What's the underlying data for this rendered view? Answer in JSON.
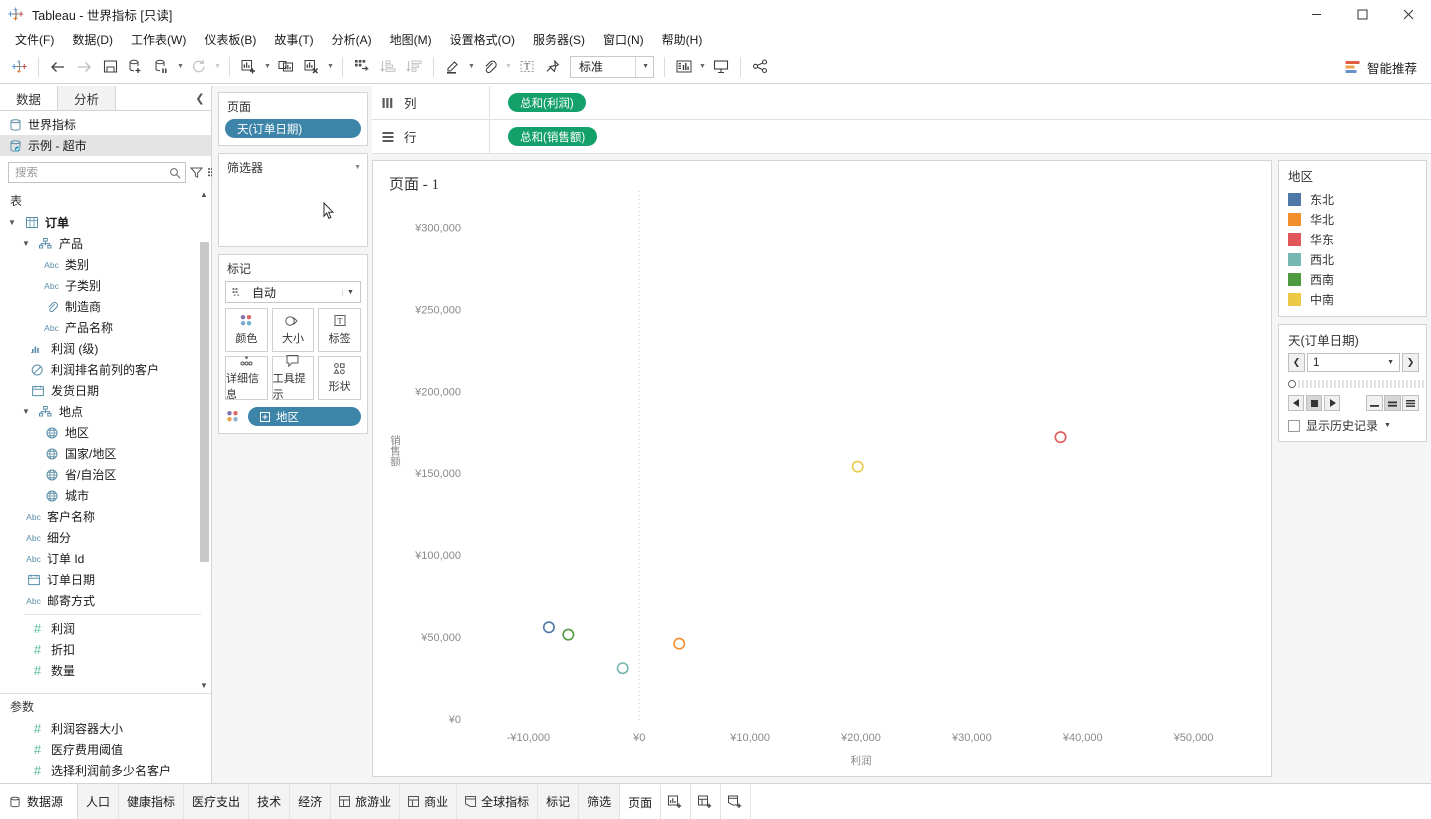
{
  "window": {
    "title": "Tableau - 世界指标 [只读]",
    "app_icon": "tableau-logo-icon",
    "minimize": "—",
    "maximize": "▢",
    "close": "✕"
  },
  "menubar": {
    "items": [
      {
        "label": "文件(F)",
        "name": "menu-file"
      },
      {
        "label": "数据(D)",
        "name": "menu-data"
      },
      {
        "label": "工作表(W)",
        "name": "menu-worksheet"
      },
      {
        "label": "仪表板(B)",
        "name": "menu-dashboard"
      },
      {
        "label": "故事(T)",
        "name": "menu-story"
      },
      {
        "label": "分析(A)",
        "name": "menu-analysis"
      },
      {
        "label": "地图(M)",
        "name": "menu-map"
      },
      {
        "label": "设置格式(O)",
        "name": "menu-format"
      },
      {
        "label": "服务器(S)",
        "name": "menu-server"
      },
      {
        "label": "窗口(N)",
        "name": "menu-window"
      },
      {
        "label": "帮助(H)",
        "name": "menu-help"
      }
    ]
  },
  "toolbar": {
    "fit_value": "标准",
    "show_me_label": "智能推荐",
    "icons": [
      "tableau-home-icon",
      "back-arrow-icon",
      "forward-arrow-icon",
      "save-icon",
      "new-data-source-icon",
      "pause-data-updates-icon",
      "refresh-data-source-icon",
      "new-worksheet-icon",
      "duplicate-sheet-icon",
      "clear-sheet-icon",
      "swap-rows-columns-icon",
      "sort-ascending-icon",
      "sort-descending-icon",
      "highlight-icon",
      "group-members-icon",
      "show-mark-labels-icon",
      "fix-axes-icon",
      "presentation-mode-icon",
      "show-dashboard-icon",
      "share-icon"
    ]
  },
  "left_pane": {
    "tabs": [
      {
        "label": "数据",
        "name": "tab-data",
        "active": true
      },
      {
        "label": "分析",
        "name": "tab-analytics",
        "active": false
      }
    ],
    "collapse_icon": "chevron-left-icon",
    "data_sources": [
      {
        "label": "世界指标",
        "name": "datasource-world-indicators",
        "selected": false,
        "icon": "database-icon"
      },
      {
        "label": "示例 - 超市",
        "name": "datasource-sample-superstore",
        "selected": true,
        "icon": "database-live-icon"
      }
    ],
    "search": {
      "placeholder": "搜索",
      "value": "",
      "icon": "search-icon"
    },
    "search_buttons": [
      "filter-funnel-icon",
      "group-by-folder-icon",
      "chevron-down-icon"
    ],
    "sections": [
      {
        "title": "表",
        "name": "section-tables"
      },
      {
        "title": "参数",
        "name": "section-parameters"
      }
    ],
    "fields": [
      {
        "label": "订单",
        "type": "table",
        "indent": 0,
        "expanded": true,
        "icon": "table-icon",
        "bold": true
      },
      {
        "label": "产品",
        "type": "hierarchy",
        "indent": 1,
        "expanded": true,
        "icon": "hierarchy-icon"
      },
      {
        "label": "类别",
        "type": "string",
        "indent": 2,
        "icon": "abc-icon"
      },
      {
        "label": "子类别",
        "type": "string",
        "indent": 2,
        "icon": "abc-icon"
      },
      {
        "label": "制造商",
        "type": "linked",
        "indent": 2,
        "icon": "paperclip-icon"
      },
      {
        "label": "产品名称",
        "type": "string",
        "indent": 2,
        "icon": "abc-icon"
      },
      {
        "label": "利润 (级)",
        "type": "bin",
        "indent": 1,
        "icon": "bin-icon"
      },
      {
        "label": "利润排名前列的客户",
        "type": "set",
        "indent": 1,
        "icon": "set-icon"
      },
      {
        "label": "发货日期",
        "type": "date",
        "indent": 1,
        "icon": "calendar-icon"
      },
      {
        "label": "地点",
        "type": "hierarchy",
        "indent": 1,
        "expanded": true,
        "icon": "hierarchy-icon"
      },
      {
        "label": "地区",
        "type": "geo",
        "indent": 2,
        "icon": "globe-icon"
      },
      {
        "label": "国家/地区",
        "type": "geo",
        "indent": 2,
        "icon": "globe-icon"
      },
      {
        "label": "省/自治区",
        "type": "geo",
        "indent": 2,
        "icon": "globe-icon"
      },
      {
        "label": "城市",
        "type": "geo",
        "indent": 2,
        "icon": "globe-icon"
      },
      {
        "label": "客户名称",
        "type": "string",
        "indent": 1,
        "icon": "abc-icon"
      },
      {
        "label": "细分",
        "type": "string",
        "indent": 1,
        "icon": "abc-icon"
      },
      {
        "label": "订单 Id",
        "type": "string",
        "indent": 1,
        "icon": "abc-icon"
      },
      {
        "label": "订单日期",
        "type": "date",
        "indent": 1,
        "icon": "calendar-icon"
      },
      {
        "label": "邮寄方式",
        "type": "string",
        "indent": 1,
        "icon": "abc-icon"
      },
      {
        "label": "利润",
        "type": "measure",
        "indent": 1,
        "icon": "hash-icon",
        "divider_before": true
      },
      {
        "label": "折扣",
        "type": "measure",
        "indent": 1,
        "icon": "hash-icon"
      },
      {
        "label": "数量",
        "type": "measure",
        "indent": 1,
        "icon": "hash-icon"
      }
    ],
    "parameters": [
      {
        "label": "利润容器大小",
        "icon": "hash-icon"
      },
      {
        "label": "医疗费用阈值",
        "icon": "hash-icon"
      },
      {
        "label": "选择利润前多少名客户",
        "icon": "hash-icon"
      }
    ]
  },
  "cards": {
    "pages": {
      "title": "页面",
      "pill": "天(订单日期)",
      "pill_color": "#3d85a8"
    },
    "filters": {
      "title": "筛选器",
      "items": []
    },
    "marks": {
      "title": "标记",
      "mark_type": "自动",
      "mark_type_icon": "automatic-marks-icon",
      "buttons": [
        {
          "label": "颜色",
          "name": "marks-color-button",
          "icon": "color-dots-icon"
        },
        {
          "label": "大小",
          "name": "marks-size-button",
          "icon": "size-icon"
        },
        {
          "label": "标签",
          "name": "marks-label-button",
          "icon": "label-text-icon"
        },
        {
          "label": "详细信息",
          "name": "marks-detail-button",
          "icon": "detail-dots-icon"
        },
        {
          "label": "工具提示",
          "name": "marks-tooltip-button",
          "icon": "tooltip-icon"
        },
        {
          "label": "形状",
          "name": "marks-shape-button",
          "icon": "shape-icon"
        }
      ],
      "pill": "地区",
      "pill_icon": "plus-box-icon",
      "pill_color": "#3d85a8"
    }
  },
  "shelves": {
    "columns": {
      "label": "列",
      "icon": "columns-icon",
      "pill": "总和(利润)"
    },
    "rows": {
      "label": "行",
      "icon": "rows-icon",
      "pill": "总和(销售额)"
    }
  },
  "chart_data": {
    "type": "scatter",
    "title": "页面 - 1",
    "xlabel": "利润",
    "ylabel": "销售额",
    "xlim": [
      -15000,
      55000
    ],
    "ylim": [
      0,
      310000
    ],
    "xticks": [
      "-¥10,000",
      "¥0",
      "¥10,000",
      "¥20,000",
      "¥30,000",
      "¥40,000",
      "¥50,000"
    ],
    "xtick_values": [
      -10000,
      0,
      10000,
      20000,
      30000,
      40000,
      50000
    ],
    "yticks": [
      "¥0",
      "¥50,000",
      "¥100,000",
      "¥150,000",
      "¥200,000",
      "¥250,000",
      "¥300,000"
    ],
    "ytick_values": [
      0,
      50000,
      100000,
      150000,
      200000,
      250000,
      300000
    ],
    "grid": false,
    "zero_line_x": 0,
    "legend_title": "地区",
    "series": [
      {
        "name": "东北",
        "color": "#4e79a7",
        "x": -8150,
        "y": 56000
      },
      {
        "name": "华北",
        "color": "#f28e2b",
        "x": 3600,
        "y": 46000
      },
      {
        "name": "华东",
        "color": "#e15759",
        "x": 38000,
        "y": 172000
      },
      {
        "name": "西北",
        "color": "#76b7b2",
        "x": -1500,
        "y": 31000
      },
      {
        "name": "西南",
        "color": "#4e9a3e",
        "x": -6400,
        "y": 51500
      },
      {
        "name": "中南",
        "color": "#edc948",
        "x": 19700,
        "y": 154000
      }
    ]
  },
  "legend": {
    "title": "地区",
    "items": [
      {
        "label": "东北",
        "color": "#4e79a7"
      },
      {
        "label": "华北",
        "color": "#f28e2b"
      },
      {
        "label": "华东",
        "color": "#e15759"
      },
      {
        "label": "西北",
        "color": "#76b7b2"
      },
      {
        "label": "西南",
        "color": "#4e9a3e"
      },
      {
        "label": "中南",
        "color": "#edc948"
      }
    ]
  },
  "pages_card": {
    "title": "天(订单日期)",
    "current_value": "1",
    "prev_icon": "chevron-left-icon",
    "next_icon": "chevron-right-icon",
    "dropdown_icon": "chevron-down-icon",
    "play_back_icon": "play-back-icon",
    "stop_icon": "stop-icon",
    "play_forward_icon": "play-forward-icon",
    "speed_slow_icon": "speed-slow-icon",
    "speed_medium_icon": "speed-medium-icon",
    "speed_fast_icon": "speed-fast-icon",
    "show_history_label": "显示历史记录",
    "show_history_checked": false
  },
  "bottom_bar": {
    "data_source_label": "数据源",
    "data_source_icon": "database-icon",
    "tabs": [
      {
        "label": "人口",
        "icon": null,
        "active": false
      },
      {
        "label": "健康指标",
        "icon": null,
        "active": false
      },
      {
        "label": "医疗支出",
        "icon": null,
        "active": false
      },
      {
        "label": "技术",
        "icon": null,
        "active": false
      },
      {
        "label": "经济",
        "icon": null,
        "active": false
      },
      {
        "label": "旅游业",
        "icon": "dashboard-icon",
        "active": false
      },
      {
        "label": "商业",
        "icon": "dashboard-icon",
        "active": false
      },
      {
        "label": "全球指标",
        "icon": "story-icon",
        "active": false
      },
      {
        "label": "标记",
        "icon": null,
        "active": false
      },
      {
        "label": "筛选",
        "icon": null,
        "active": false
      },
      {
        "label": "页面",
        "icon": null,
        "active": true
      }
    ],
    "new_buttons": [
      {
        "name": "new-worksheet-button",
        "icon": "new-worksheet-icon"
      },
      {
        "name": "new-dashboard-button",
        "icon": "new-dashboard-icon"
      },
      {
        "name": "new-story-button",
        "icon": "new-story-icon"
      }
    ]
  }
}
